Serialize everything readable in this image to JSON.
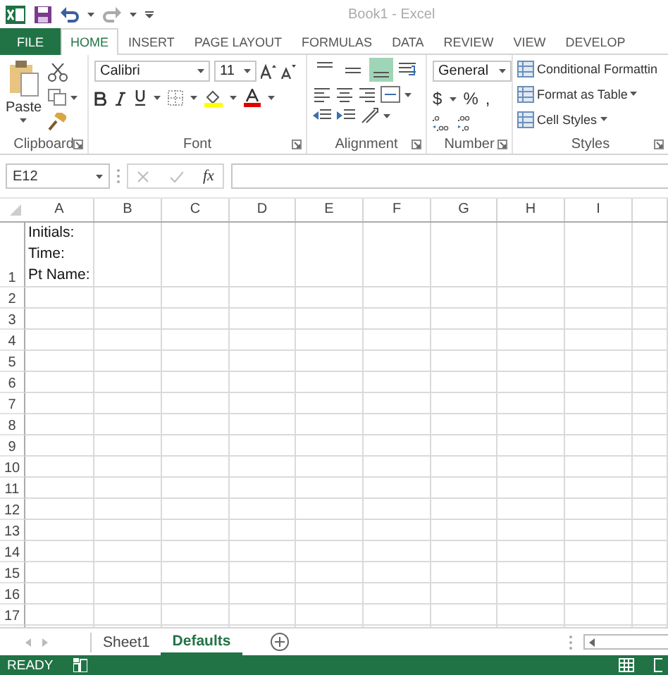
{
  "title_bar": {
    "title": "Book1 - Excel"
  },
  "ribbon_tabs": [
    {
      "label": "FILE",
      "kind": "file",
      "selected": false
    },
    {
      "label": "HOME",
      "kind": "tab",
      "selected": true
    },
    {
      "label": "INSERT",
      "kind": "tab",
      "selected": false
    },
    {
      "label": "PAGE LAYOUT",
      "kind": "tab",
      "selected": false
    },
    {
      "label": "FORMULAS",
      "kind": "tab",
      "selected": false
    },
    {
      "label": "DATA",
      "kind": "tab",
      "selected": false
    },
    {
      "label": "REVIEW",
      "kind": "tab",
      "selected": false
    },
    {
      "label": "VIEW",
      "kind": "tab",
      "selected": false
    },
    {
      "label": "DEVELOP",
      "kind": "tab",
      "selected": false
    }
  ],
  "ribbon": {
    "clipboard": {
      "label": "Clipboard",
      "paste": "Paste"
    },
    "font": {
      "label": "Font",
      "font_name": "Calibri",
      "font_size": "11"
    },
    "alignment": {
      "label": "Alignment",
      "buttons": [
        {
          "kind": "top",
          "on": false
        },
        {
          "kind": "middle",
          "on": false
        },
        {
          "kind": "bottom",
          "on": true
        }
      ]
    },
    "number": {
      "label": "Number",
      "format": "General",
      "currency": "$",
      "percent": "%",
      "comma": ","
    },
    "styles": {
      "label": "Styles",
      "items": [
        "Conditional Formattin",
        "Format as Table",
        "Cell Styles"
      ]
    }
  },
  "formula_bar": {
    "name_box": "E12",
    "function_label": "fx"
  },
  "sheet": {
    "columns": [
      "A",
      "B",
      "C",
      "D",
      "E",
      "F",
      "G",
      "H",
      "I"
    ],
    "rows": [
      {
        "header": "1",
        "cells": [
          "Initials:\nTime:\nPt Name:"
        ]
      },
      {
        "header": "2",
        "cells": []
      },
      {
        "header": "3",
        "cells": []
      },
      {
        "header": "4",
        "cells": []
      },
      {
        "header": "5",
        "cells": []
      },
      {
        "header": "6",
        "cells": []
      },
      {
        "header": "7",
        "cells": []
      },
      {
        "header": "8",
        "cells": []
      },
      {
        "header": "9",
        "cells": []
      },
      {
        "header": "10",
        "cells": []
      },
      {
        "header": "11",
        "cells": []
      },
      {
        "header": "12",
        "cells": []
      },
      {
        "header": "13",
        "cells": []
      },
      {
        "header": "14",
        "cells": []
      },
      {
        "header": "15",
        "cells": []
      },
      {
        "header": "16",
        "cells": []
      },
      {
        "header": "17",
        "cells": []
      }
    ]
  },
  "sheet_tabs": [
    {
      "label": "Sheet1",
      "selected": false
    },
    {
      "label": "Defaults",
      "selected": true
    }
  ],
  "status_bar": {
    "status": "READY"
  }
}
